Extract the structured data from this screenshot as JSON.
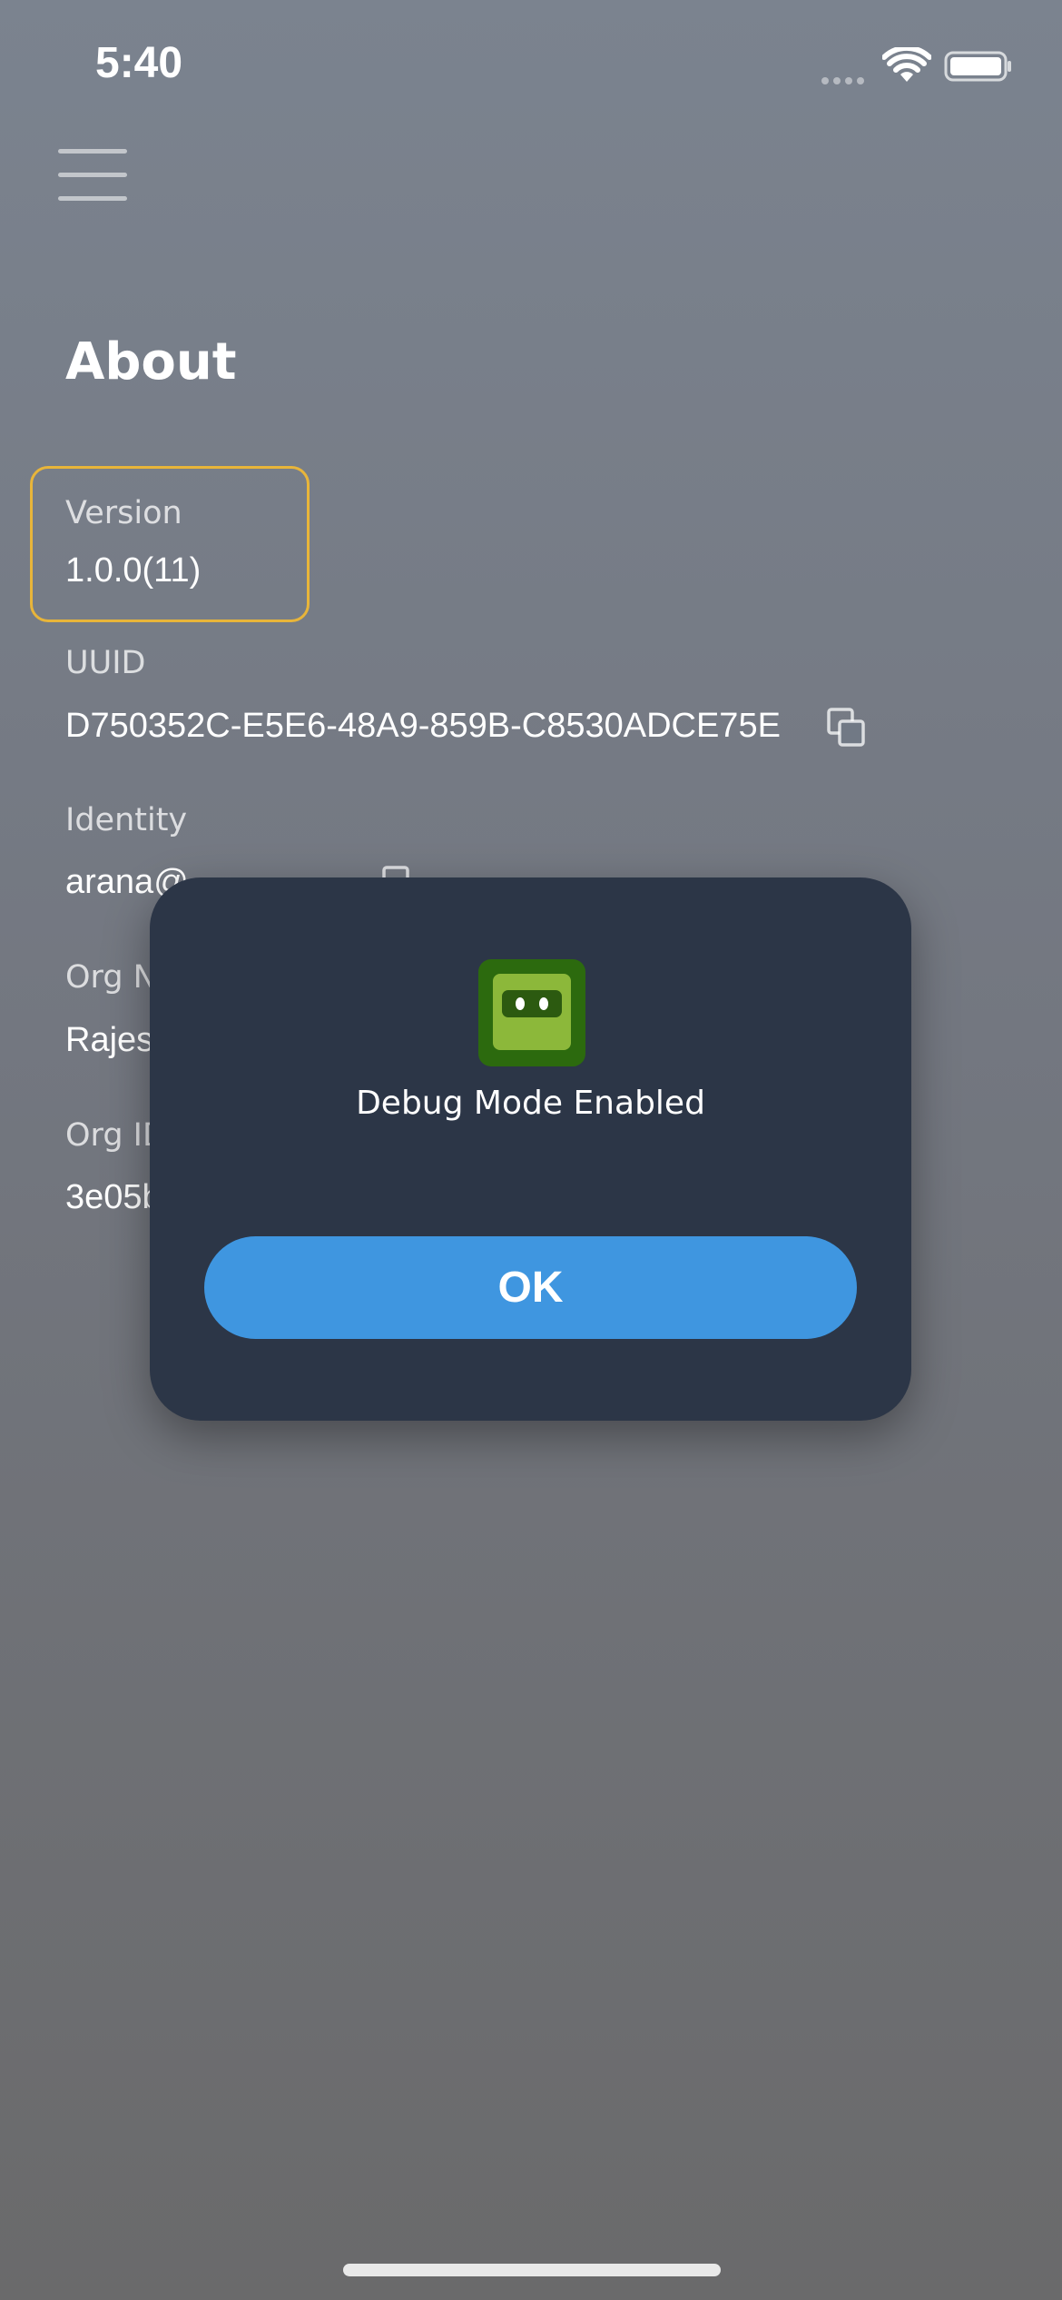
{
  "status_bar": {
    "time": "5:40"
  },
  "page": {
    "title": "About"
  },
  "fields": {
    "version": {
      "label": "Version",
      "value": "1.0.0(11)"
    },
    "uuid": {
      "label": "UUID",
      "value": "D750352C-E5E6-48A9-859B-C8530ADCE75E"
    },
    "identity": {
      "label": "Identity",
      "value": "arana@"
    },
    "org_name": {
      "label": "Org N",
      "value": "Rajes"
    },
    "org_id": {
      "label": "Org ID",
      "value": "3e05b"
    }
  },
  "dialog": {
    "message": "Debug Mode Enabled",
    "ok_label": "OK"
  },
  "icons": {
    "menu": "hamburger-menu-icon",
    "copy": "copy-icon",
    "app": "robot-app-icon",
    "wifi": "wifi-icon",
    "battery": "battery-icon"
  },
  "colors": {
    "accent": "#3f96e0",
    "highlight_border": "#e8b53a",
    "dialog_bg": "#2c3647",
    "app_icon_dark": "#2c6a0e",
    "app_icon_light": "#8cb83a"
  }
}
